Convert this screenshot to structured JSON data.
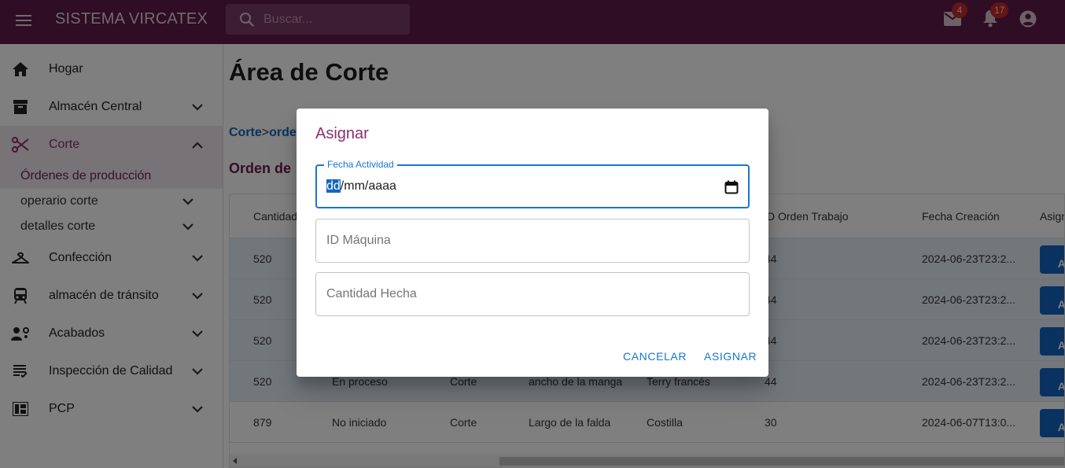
{
  "app": {
    "title": "SISTEMA VIRCATEX"
  },
  "search": {
    "placeholder": "Buscar..."
  },
  "topbar": {
    "mail_count": "4",
    "notif_count": "17"
  },
  "sidebar": {
    "items": [
      {
        "label": "Hogar",
        "icon": "home-icon"
      },
      {
        "label": "Almacén Central",
        "icon": "archive-icon"
      },
      {
        "label": "Corte",
        "icon": "scissors-icon"
      },
      {
        "label": "Confección",
        "icon": "hanger-icon"
      },
      {
        "label": "almacén de tránsito",
        "icon": "train-icon"
      },
      {
        "label": "Acabados",
        "icon": "people-gear-icon"
      },
      {
        "label": "Inspección de Calidad",
        "icon": "checklist-icon"
      },
      {
        "label": "PCP",
        "icon": "dashboard-icon"
      }
    ],
    "subitems": [
      {
        "label": "Órdenes de producción"
      },
      {
        "label": "operario corte"
      },
      {
        "label": "detalles corte"
      }
    ]
  },
  "main": {
    "title": "Área de Corte",
    "breadcrumb": {
      "first": "Corte",
      "sep": ">",
      "second": "orde"
    },
    "section_title": "Orden de",
    "table": {
      "headers": [
        "Cantidad",
        "D Orden Trabajo",
        "Fecha Creación",
        "Asign"
      ],
      "rows": [
        {
          "cantidad": "520",
          "estado": "",
          "area": "",
          "detalle": "",
          "tela": "",
          "orden": "44",
          "fecha": "2024-06-23T23:2...",
          "btn": "AS"
        },
        {
          "cantidad": "520",
          "estado": "",
          "area": "",
          "detalle": "",
          "tela": "",
          "orden": "44",
          "fecha": "2024-06-23T23:2...",
          "btn": "AS"
        },
        {
          "cantidad": "520",
          "estado": "",
          "area": "",
          "detalle": "",
          "tela": "",
          "orden": "44",
          "fecha": "2024-06-23T23:2...",
          "btn": "AS"
        },
        {
          "cantidad": "520",
          "estado": "En proceso",
          "area": "Corte",
          "detalle": "ancho de la manga",
          "tela": "Terry francés",
          "orden": "44",
          "fecha": "2024-06-23T23:2...",
          "btn": "AS"
        },
        {
          "cantidad": "879",
          "estado": "No iniciado",
          "area": "Corte",
          "detalle": "Largo de la falda",
          "tela": "Costilla",
          "orden": "30",
          "fecha": "2024-06-07T13:0...",
          "btn": "AS"
        }
      ]
    }
  },
  "dialog": {
    "title": "Asignar",
    "date_label": "Fecha Actividad",
    "date_dd": "dd",
    "date_rest": "/mm/aaaa",
    "machine_placeholder": "ID Máquina",
    "qty_placeholder": "Cantidad Hecha",
    "cancel_label": "CANCELAR",
    "assign_label": "ASIGNAR"
  },
  "colors": {
    "topbar": "#5c1a4a",
    "accent": "#8e2d6b",
    "primary": "#1976d2"
  }
}
